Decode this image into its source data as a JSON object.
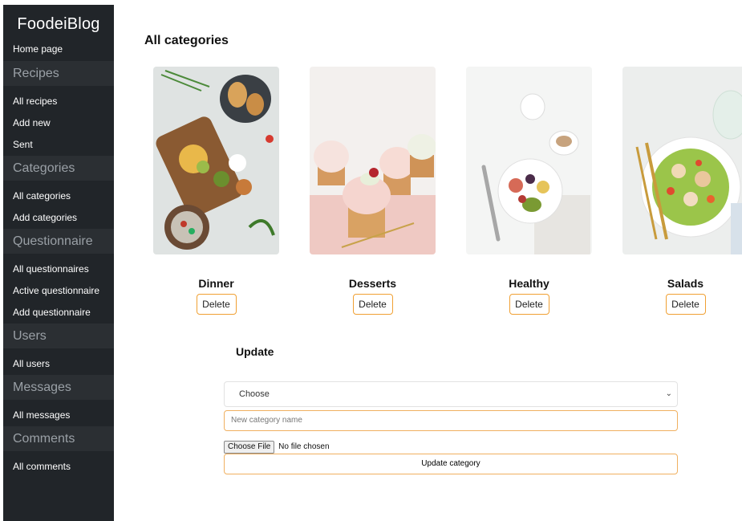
{
  "sidebar": {
    "brand": "FoodeiBlog",
    "home": "Home page",
    "sections": [
      {
        "title": "Recipes",
        "items": [
          "All recipes",
          "Add new",
          "Sent"
        ]
      },
      {
        "title": "Categories",
        "items": [
          "All categories",
          "Add categories"
        ]
      },
      {
        "title": "Questionnaire",
        "items": [
          "All questionnaires",
          "Active questionnaire",
          "Add questionnaire"
        ]
      },
      {
        "title": "Users",
        "items": [
          "All users"
        ]
      },
      {
        "title": "Messages",
        "items": [
          "All messages"
        ]
      },
      {
        "title": "Comments",
        "items": [
          "All comments"
        ]
      }
    ]
  },
  "main": {
    "title": "All categories",
    "categories": [
      {
        "name": "Dinner",
        "delete_label": "Delete",
        "image": "dinner-platter"
      },
      {
        "name": "Desserts",
        "delete_label": "Delete",
        "image": "cupcakes"
      },
      {
        "name": "Healthy",
        "delete_label": "Delete",
        "image": "fruit-bowl"
      },
      {
        "name": "Salads",
        "delete_label": "Delete",
        "image": "salad-plate"
      }
    ]
  },
  "update": {
    "title": "Update",
    "select_value": "Choose",
    "name_placeholder": "New category name",
    "file_button": "Choose File",
    "file_status": "No file chosen",
    "submit_label": "Update category"
  },
  "colors": {
    "sidebar_bg": "#212529",
    "section_bg": "#2b2f33",
    "accent_border": "#f0a033"
  }
}
